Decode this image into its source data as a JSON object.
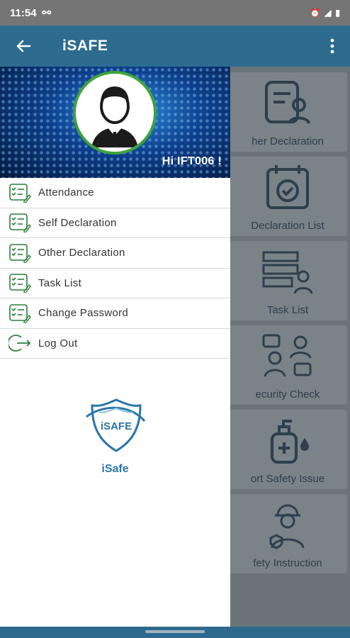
{
  "status_bar": {
    "time": "11:54"
  },
  "app_bar": {
    "title": "iSAFE"
  },
  "drawer": {
    "greeting": "Hi  IFT006 !",
    "menu": [
      {
        "label": "Attendance",
        "icon": "checklist-icon"
      },
      {
        "label": "Self Declaration",
        "icon": "checklist-icon"
      },
      {
        "label": "Other Declaration",
        "icon": "checklist-icon"
      },
      {
        "label": "Task List",
        "icon": "checklist-icon"
      },
      {
        "label": "Change Password",
        "icon": "checklist-icon"
      },
      {
        "label": "Log Out",
        "icon": "logout-icon"
      }
    ],
    "logo_text": "iSAFE",
    "logo_caption": "iSafe"
  },
  "background_cards": [
    {
      "label": "her Declaration",
      "icon": "document-user-icon"
    },
    {
      "label": "Declaration List",
      "icon": "calendar-check-icon"
    },
    {
      "label": "Task List",
      "icon": "task-list-icon"
    },
    {
      "label": "ecurity Check",
      "icon": "security-check-icon"
    },
    {
      "label": "ort Safety Issue",
      "icon": "sanitizer-icon"
    },
    {
      "label": "fety Instruction",
      "icon": "worker-icon"
    }
  ],
  "colors": {
    "app_bar": "#2d6c8f",
    "accent_green": "#3da33b",
    "logo_blue": "#2a76a8"
  }
}
